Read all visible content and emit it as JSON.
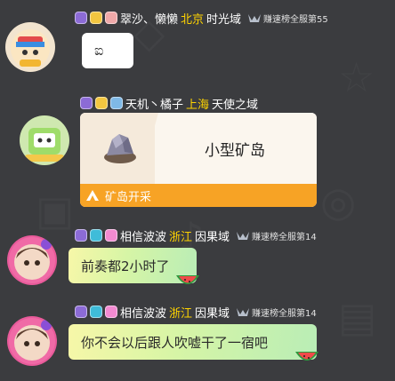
{
  "messages": [
    {
      "sender_name": "翠沙、懒懒",
      "city": "北京",
      "domain": "时光域",
      "rank": "赚速榜全服第55",
      "text": "ಐ"
    },
    {
      "sender_name": "天机丶橘子",
      "city": "上海",
      "domain": "天使之域",
      "card": {
        "title": "小型矿岛",
        "footer": "矿岛开采"
      }
    },
    {
      "sender_name": "相信波波",
      "city": "浙江",
      "domain": "因果域",
      "rank": "赚速榜全服第14",
      "text": "前奏都2小时了"
    },
    {
      "sender_name": "相信波波",
      "city": "浙江",
      "domain": "因果域",
      "rank": "赚速榜全服第14",
      "text": "你不会以后跟人吹嘘干了一宿吧"
    }
  ],
  "colors": {
    "background": "#3b3c3f",
    "city": "#ffd400",
    "card_footer": "#f7a325"
  }
}
